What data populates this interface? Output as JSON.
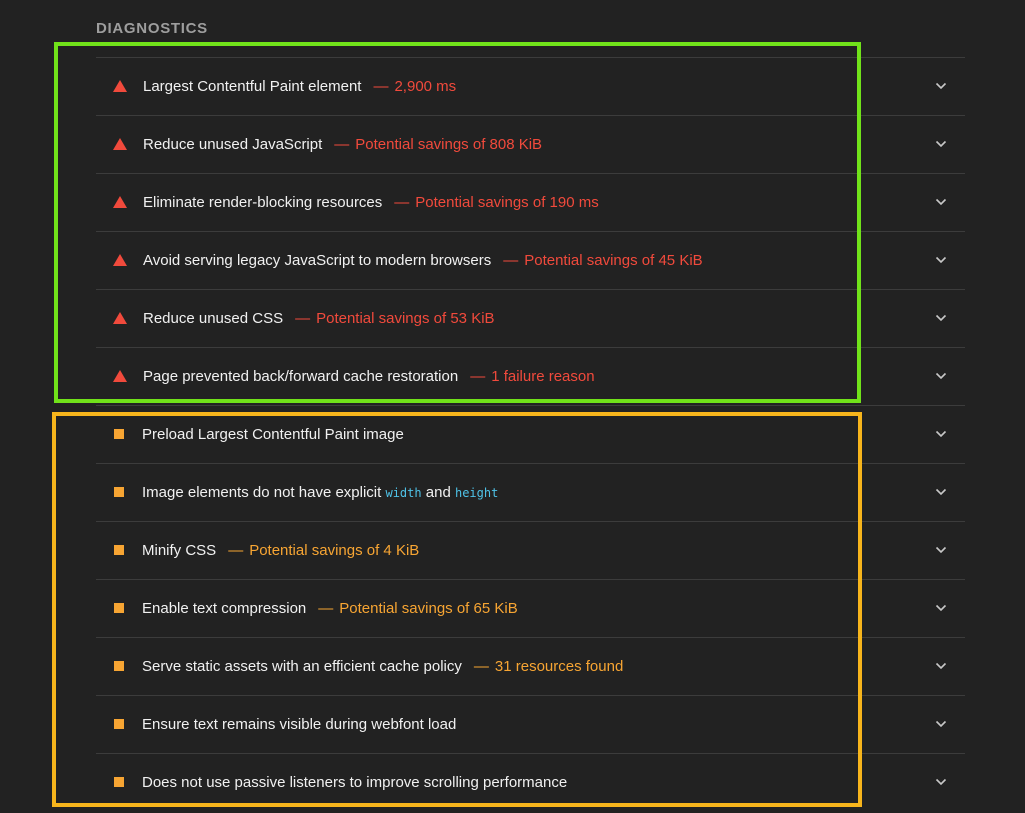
{
  "section": {
    "title": "DIAGNOSTICS"
  },
  "separator": "—",
  "audits": [
    {
      "icon": "triangle-warning-icon",
      "severity": "fail",
      "title": "Largest Contentful Paint element",
      "display_value": "2,900 ms"
    },
    {
      "icon": "triangle-warning-icon",
      "severity": "fail",
      "title": "Reduce unused JavaScript",
      "display_value": "Potential savings of 808 KiB"
    },
    {
      "icon": "triangle-warning-icon",
      "severity": "fail",
      "title": "Eliminate render-blocking resources",
      "display_value": "Potential savings of 190 ms"
    },
    {
      "icon": "triangle-warning-icon",
      "severity": "fail",
      "title": "Avoid serving legacy JavaScript to modern browsers",
      "display_value": "Potential savings of 45 KiB"
    },
    {
      "icon": "triangle-warning-icon",
      "severity": "fail",
      "title": "Reduce unused CSS",
      "display_value": "Potential savings of 53 KiB"
    },
    {
      "icon": "triangle-warning-icon",
      "severity": "fail",
      "title": "Page prevented back/forward cache restoration",
      "display_value": "1 failure reason"
    },
    {
      "icon": "square-average-icon",
      "severity": "warn",
      "title": "Preload Largest Contentful Paint image",
      "display_value": ""
    },
    {
      "icon": "square-average-icon",
      "severity": "warn",
      "title_parts": [
        "Image elements do not have explicit ",
        "width",
        " and ",
        "height"
      ],
      "display_value": ""
    },
    {
      "icon": "square-average-icon",
      "severity": "warn",
      "title": "Minify CSS",
      "display_value": "Potential savings of 4 KiB"
    },
    {
      "icon": "square-average-icon",
      "severity": "warn",
      "title": "Enable text compression",
      "display_value": "Potential savings of 65 KiB"
    },
    {
      "icon": "square-average-icon",
      "severity": "warn",
      "title": "Serve static assets with an efficient cache policy",
      "display_value": "31 resources found"
    },
    {
      "icon": "square-average-icon",
      "severity": "warn",
      "title": "Ensure text remains visible during webfont load",
      "display_value": ""
    },
    {
      "icon": "square-average-icon",
      "severity": "warn",
      "title": "Does not use passive listeners to improve scrolling performance",
      "display_value": ""
    }
  ],
  "colors": {
    "background": "#222222",
    "fail": "#f14a3c",
    "warn": "#f7a533",
    "code": "#4fc3e8",
    "highlight_green": "#71e21a",
    "highlight_orange": "#f7b51c"
  }
}
